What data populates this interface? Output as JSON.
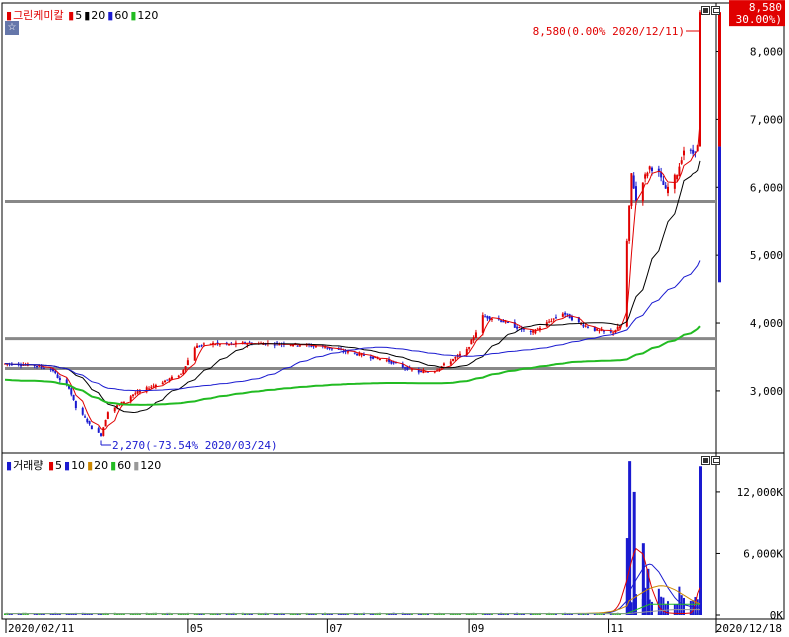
{
  "colors": {
    "up": "#e00000",
    "down": "#1a1ad0",
    "ma5": "#e00000",
    "ma20": "#000000",
    "ma60": "#1a1ad0",
    "ma120": "#22bb22",
    "vma10": "#1a1ad0",
    "vma20": "#cc8800",
    "vma120": "#999999",
    "hline": "#888888"
  },
  "price_panel": {
    "name": "그린케미칼",
    "legend": [
      {
        "label": "5",
        "color": "#e00000"
      },
      {
        "label": "20",
        "color": "#000000"
      },
      {
        "label": "60",
        "color": "#1a1ad0"
      },
      {
        "label": "120",
        "color": "#22bb22"
      }
    ],
    "current_price_box": {
      "line1": "8,580",
      "line2": "( 30.00%)"
    },
    "high_annotation": "8,580(0.00% 2020/12/11)",
    "low_annotation": "2,270(-73.54% 2020/03/24)",
    "y_ticks": [
      "3,000",
      "4,000",
      "5,000",
      "6,000",
      "7,000",
      "8,000"
    ]
  },
  "volume_panel": {
    "name": "거래량",
    "legend": [
      {
        "label": "5",
        "color": "#e00000"
      },
      {
        "label": "10",
        "color": "#1a1ad0"
      },
      {
        "label": "20",
        "color": "#cc8800"
      },
      {
        "label": "60",
        "color": "#22bb22"
      },
      {
        "label": "120",
        "color": "#999999"
      }
    ],
    "y_ticks": [
      "0K",
      "6,000K",
      "12,000K"
    ]
  },
  "x_axis": {
    "labels": [
      "2020/02/11",
      "05",
      "07",
      "09",
      "11",
      "2020/12/18"
    ]
  },
  "chart_data": {
    "type": "candlestick",
    "title": "그린케미칼",
    "x_range": [
      "2020/02/11",
      "2020/12/18"
    ],
    "price_ylim": [
      2100,
      8700
    ],
    "volume_ylim": [
      0,
      15500
    ],
    "volume_unit": "K",
    "horizontal_lines": [
      3330,
      3770,
      5790
    ],
    "price_series": [
      {
        "date": "2020-02-11",
        "close": 3400
      },
      {
        "date": "2020-02-18",
        "close": 3390
      },
      {
        "date": "2020-02-25",
        "close": 3370
      },
      {
        "date": "2020-03-03",
        "close": 3300
      },
      {
        "date": "2020-03-06",
        "close": 3150
      },
      {
        "date": "2020-03-10",
        "close": 3050
      },
      {
        "date": "2020-03-13",
        "close": 2750
      },
      {
        "date": "2020-03-17",
        "close": 2600
      },
      {
        "date": "2020-03-20",
        "close": 2450
      },
      {
        "date": "2020-03-24",
        "close": 2350
      },
      {
        "date": "2020-03-27",
        "close": 2700
      },
      {
        "date": "2020-04-01",
        "close": 2800
      },
      {
        "date": "2020-04-07",
        "close": 2950
      },
      {
        "date": "2020-04-14",
        "close": 3050
      },
      {
        "date": "2020-04-21",
        "close": 3150
      },
      {
        "date": "2020-04-28",
        "close": 3250
      },
      {
        "date": "2020-05-04",
        "close": 3650
      },
      {
        "date": "2020-05-11",
        "close": 3700
      },
      {
        "date": "2020-05-18",
        "close": 3680
      },
      {
        "date": "2020-05-25",
        "close": 3700
      },
      {
        "date": "2020-06-01",
        "close": 3700
      },
      {
        "date": "2020-06-15",
        "close": 3690
      },
      {
        "date": "2020-06-29",
        "close": 3650
      },
      {
        "date": "2020-07-06",
        "close": 3600
      },
      {
        "date": "2020-07-13",
        "close": 3550
      },
      {
        "date": "2020-07-20",
        "close": 3500
      },
      {
        "date": "2020-07-27",
        "close": 3450
      },
      {
        "date": "2020-08-03",
        "close": 3350
      },
      {
        "date": "2020-08-10",
        "close": 3280
      },
      {
        "date": "2020-08-17",
        "close": 3300
      },
      {
        "date": "2020-08-24",
        "close": 3450
      },
      {
        "date": "2020-08-31",
        "close": 3600
      },
      {
        "date": "2020-09-03",
        "close": 3800
      },
      {
        "date": "2020-09-07",
        "close": 4100
      },
      {
        "date": "2020-09-14",
        "close": 4050
      },
      {
        "date": "2020-09-21",
        "close": 3950
      },
      {
        "date": "2020-09-28",
        "close": 3850
      },
      {
        "date": "2020-10-05",
        "close": 4000
      },
      {
        "date": "2020-10-12",
        "close": 4150
      },
      {
        "date": "2020-10-19",
        "close": 4000
      },
      {
        "date": "2020-10-26",
        "close": 3900
      },
      {
        "date": "2020-11-02",
        "close": 3850
      },
      {
        "date": "2020-11-06",
        "close": 3950
      },
      {
        "date": "2020-11-09",
        "close": 5200
      },
      {
        "date": "2020-11-11",
        "close": 6200
      },
      {
        "date": "2020-11-13",
        "close": 5800
      },
      {
        "date": "2020-11-16",
        "close": 6100
      },
      {
        "date": "2020-11-19",
        "close": 6300
      },
      {
        "date": "2020-11-23",
        "close": 6200
      },
      {
        "date": "2020-11-26",
        "close": 5950
      },
      {
        "date": "2020-12-01",
        "close": 6200
      },
      {
        "date": "2020-12-04",
        "close": 6550
      },
      {
        "date": "2020-12-08",
        "close": 6500
      },
      {
        "date": "2020-12-10",
        "close": 6600
      },
      {
        "date": "2020-12-11",
        "close": 8580
      }
    ],
    "volume_spikes": [
      {
        "date": "2020-11-09",
        "value": 7500
      },
      {
        "date": "2020-11-10",
        "value": 15000
      },
      {
        "date": "2020-11-12",
        "value": 12000
      },
      {
        "date": "2020-11-16",
        "value": 7000
      },
      {
        "date": "2020-11-18",
        "value": 4500
      },
      {
        "date": "2020-12-11",
        "value": 14500
      }
    ]
  }
}
